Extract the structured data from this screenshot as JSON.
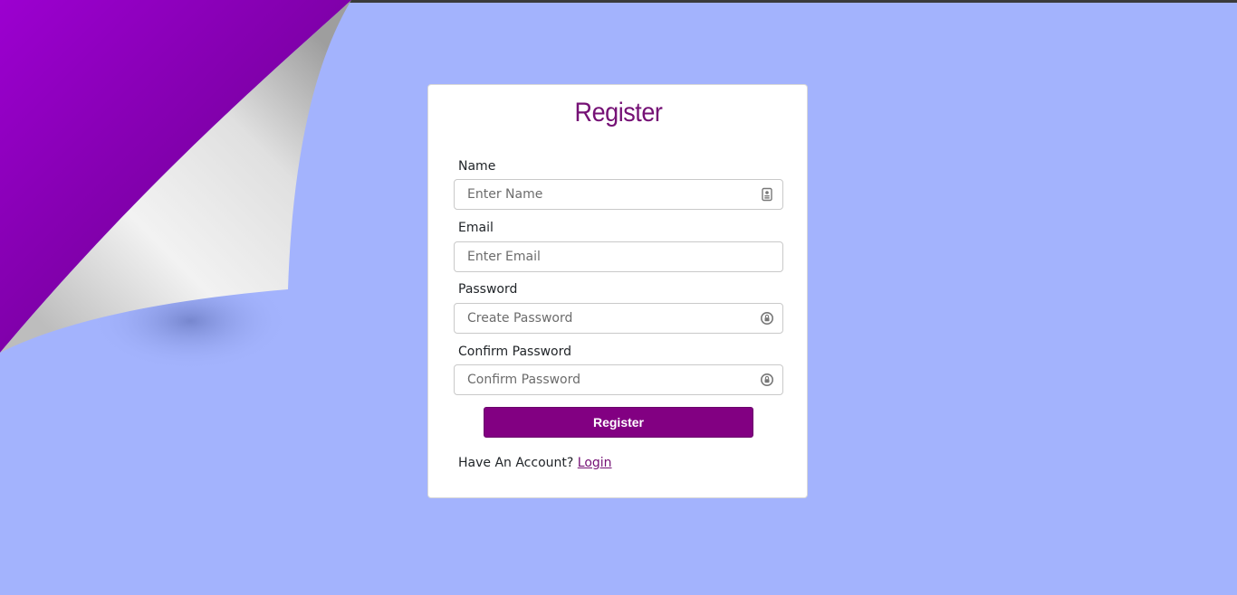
{
  "form": {
    "title": "Register",
    "fields": {
      "name": {
        "label": "Name",
        "placeholder": "Enter Name",
        "icon": "id-card-icon"
      },
      "email": {
        "label": "Email",
        "placeholder": "Enter Email"
      },
      "password": {
        "label": "Password",
        "placeholder": "Create Password",
        "icon": "lock-icon"
      },
      "confirm": {
        "label": "Confirm Password",
        "placeholder": "Confirm Password",
        "icon": "lock-icon"
      }
    },
    "submit_label": "Register",
    "account_prompt": "Have An Account?",
    "login_label": "Login"
  },
  "colors": {
    "background": "#a3b3fd",
    "accent": "#820082",
    "title": "#751175",
    "curl_purple": "#9400c6"
  }
}
